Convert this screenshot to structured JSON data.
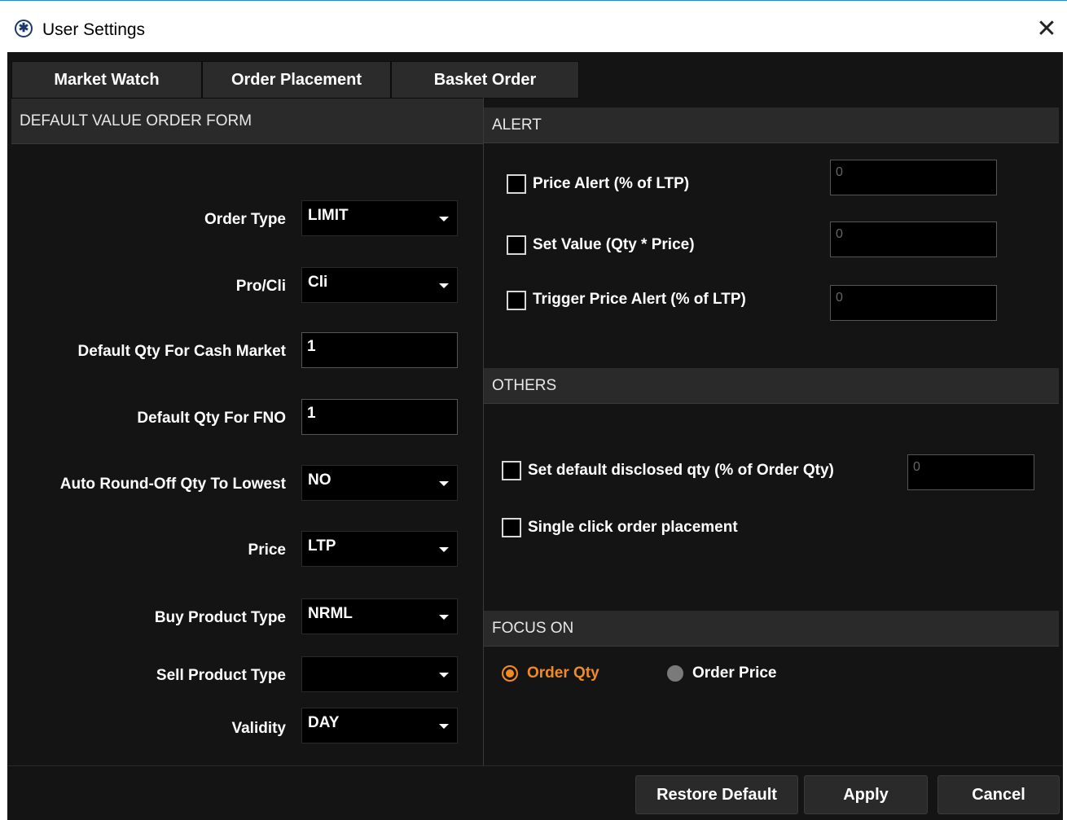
{
  "window": {
    "title": "User Settings",
    "close_glyph": "✕",
    "app_icon_glyph": "✱"
  },
  "tabs": [
    {
      "label": "Market Watch"
    },
    {
      "label": "Order Placement"
    },
    {
      "label": "Basket Order"
    }
  ],
  "left": {
    "header": "DEFAULT VALUE ORDER FORM",
    "fields": {
      "order_type": {
        "label": "Order Type",
        "value": "LIMIT"
      },
      "pro_cli": {
        "label": "Pro/Cli",
        "value": "Cli"
      },
      "qty_cash": {
        "label": "Default Qty For Cash Market",
        "value": "1"
      },
      "qty_fno": {
        "label": "Default Qty For FNO",
        "value": "1"
      },
      "auto_round": {
        "label": "Auto Round-Off Qty To Lowest",
        "value": "NO"
      },
      "price": {
        "label": "Price",
        "value": "LTP"
      },
      "buy_product": {
        "label": "Buy Product Type",
        "value": "NRML"
      },
      "sell_product": {
        "label": "Sell Product Type",
        "value": ""
      },
      "validity": {
        "label": "Validity",
        "value": "DAY"
      }
    }
  },
  "alert": {
    "header": "ALERT",
    "price_alert": {
      "label": "Price Alert (% of LTP)",
      "value": "0",
      "checked": false
    },
    "set_value": {
      "label": "Set Value (Qty * Price)",
      "value": "0",
      "checked": false
    },
    "trigger_alert": {
      "label": "Trigger Price Alert (% of LTP)",
      "value": "0",
      "checked": false
    }
  },
  "others": {
    "header": "OTHERS",
    "disclosed": {
      "label": "Set default disclosed qty (% of Order Qty)",
      "value": "0",
      "checked": false
    },
    "single_click": {
      "label": "Single click order placement",
      "checked": false
    }
  },
  "focus": {
    "header": "FOCUS ON",
    "order_qty": {
      "label": "Order Qty",
      "selected": true
    },
    "order_price": {
      "label": "Order Price",
      "selected": false
    }
  },
  "buttons": {
    "restore": "Restore Default",
    "apply": "Apply",
    "cancel": "Cancel"
  },
  "colors": {
    "accent": "#f08a24",
    "background": "#141414",
    "panel_header": "#2a2a2a",
    "title_border": "#1e88e5"
  }
}
